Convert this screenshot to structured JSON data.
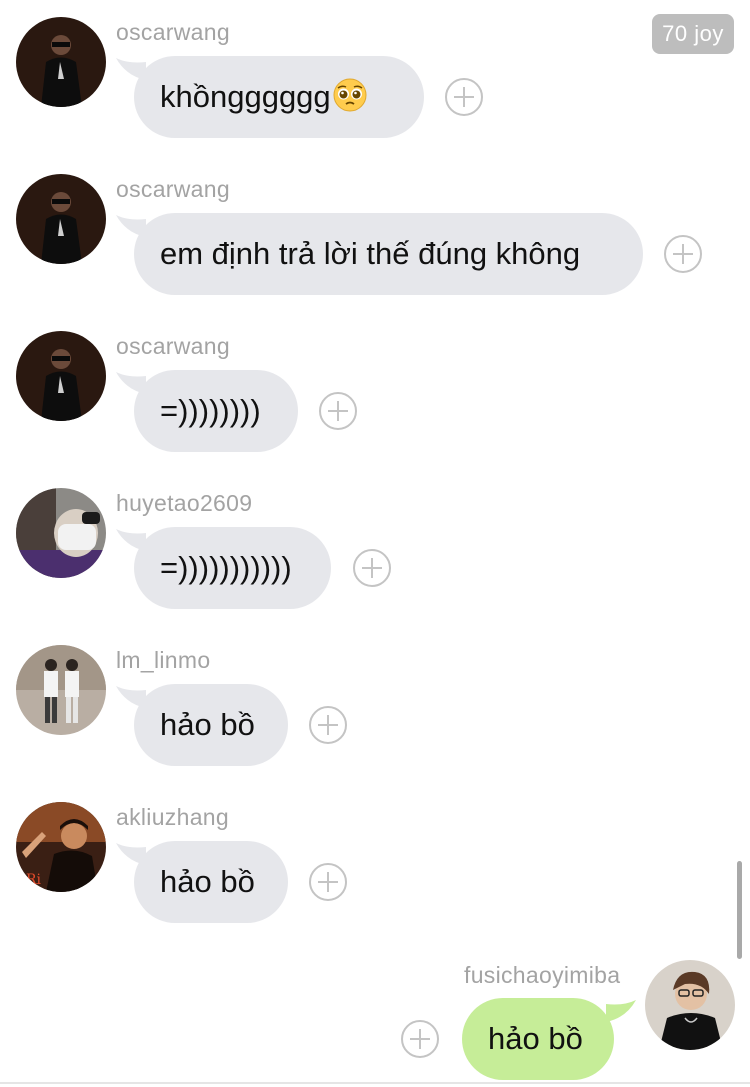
{
  "badge": {
    "label": "70 joy"
  },
  "icons": {
    "avatar": "avatar-photo",
    "react": "add-reaction-plus-icon",
    "emoji": "pleading-face-emoji"
  },
  "colors": {
    "incoming_bubble": "#e6e7eb",
    "outgoing_bubble": "#c6ed98",
    "username": "#a3a3a3",
    "badge_bg": "#bdbdbd"
  },
  "messages": [
    {
      "username": "oscarwang",
      "text": "khồngggggg",
      "emoji": "🥺",
      "direction": "incoming"
    },
    {
      "username": "oscarwang",
      "text": "em định trả lời thế đúng không",
      "direction": "incoming"
    },
    {
      "username": "oscarwang",
      "text": "=))))))))",
      "direction": "incoming"
    },
    {
      "username": "huyetao2609",
      "text": "=)))))))))))",
      "direction": "incoming"
    },
    {
      "username": "lm_linmo",
      "text": "hảo bồ",
      "direction": "incoming"
    },
    {
      "username": "akliuzhang",
      "text": "hảo bồ",
      "direction": "incoming"
    },
    {
      "username": "fusichaoyimiba",
      "text": "hảo bồ",
      "direction": "outgoing"
    }
  ]
}
